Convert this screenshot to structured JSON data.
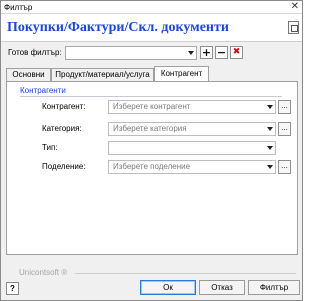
{
  "window": {
    "title": "Филтър"
  },
  "header": {
    "banner": "Покупки/Фактури/Скл. документи"
  },
  "preset": {
    "label": "Готов филтър:",
    "value": "",
    "add": "+",
    "remove": "−",
    "clear": "✖"
  },
  "tabs": [
    "Основни",
    "Продукт/материал/услуга",
    "Контрагент"
  ],
  "active_tab": "Контрагент",
  "panel": {
    "group_title": "Контрагенти",
    "fields": [
      {
        "label": "Контрагент:",
        "placeholder": "Изберете контрагент",
        "has_browse": true
      },
      {
        "label": "Категория:",
        "placeholder": "Изберете категория",
        "has_browse": true
      },
      {
        "label": "Тип:",
        "placeholder": "",
        "has_browse": false
      },
      {
        "label": "Поделение:",
        "placeholder": "Изберете поделение",
        "has_browse": true
      }
    ],
    "browse_label": "..."
  },
  "footer": {
    "brand": "Unicontsoft ®",
    "help": "?",
    "ok": "Ок",
    "cancel": "Отказ",
    "filter": "Филтър"
  }
}
